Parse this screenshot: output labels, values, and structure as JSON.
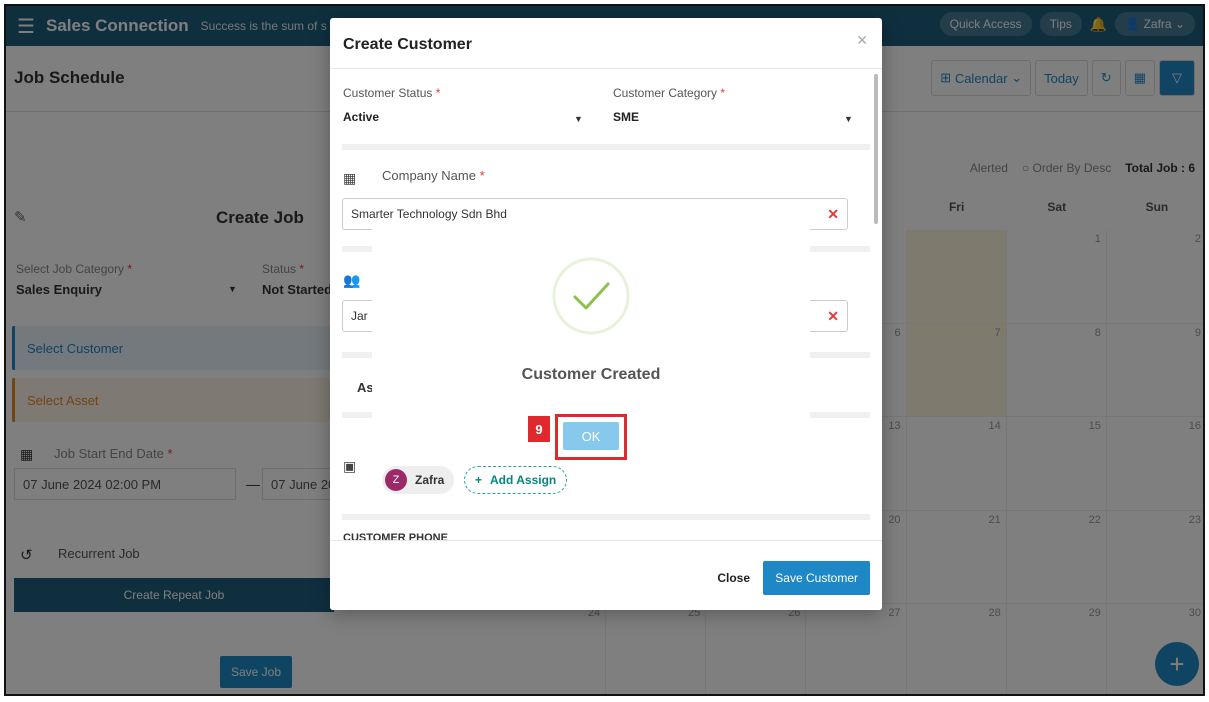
{
  "topbar": {
    "brand": "Sales Connection",
    "slogan": "Success is the sum of s",
    "quick_access": "Quick Access",
    "tips": "Tips",
    "user": "Zafra"
  },
  "page": {
    "title": "Job Schedule",
    "calendar_view": "Calendar",
    "today": "Today"
  },
  "left": {
    "title": "Create Job",
    "job_category_label": "Select Job Category",
    "job_category_value": "Sales Enquiry",
    "status_label": "Status",
    "status_value": "Not Started",
    "select_customer": "Select Customer",
    "select_asset": "Select Asset",
    "date_label": "Job Start End Date",
    "start_date": "07 June 2024 02:00 PM",
    "end_date": "07 June 20",
    "recurrent": "Recurrent Job",
    "repeat_btn": "Create Repeat Job",
    "save_btn": "Save Job"
  },
  "calendar": {
    "alerted": "Alerted",
    "order": "Order By Desc",
    "total": "Total Job : 6",
    "days": [
      "",
      "",
      "",
      "",
      "Fri",
      "Sat",
      "Sun"
    ],
    "cells": [
      "",
      "",
      "",
      "",
      "",
      "1",
      "2",
      "",
      "",
      "",
      "6",
      "7",
      "8",
      "9",
      "",
      "",
      "",
      "13",
      "14",
      "15",
      "16",
      "",
      "",
      "",
      "20",
      "21",
      "22",
      "23",
      "24",
      "25",
      "26",
      "27",
      "28",
      "29",
      "30"
    ]
  },
  "modal": {
    "title": "Create Customer",
    "customer_status_label": "Customer Status",
    "customer_status_value": "Active",
    "customer_category_label": "Customer Category",
    "customer_category_value": "SME",
    "company_label": "Company Name",
    "company_value": "Smarter Technology Sdn Bhd",
    "contact_value": "Jar",
    "assign_section_label": "As",
    "assignee": "Zafra",
    "assignee_initial": "Z",
    "add_assign": "Add Assign",
    "customer_phone": "CUSTOMER PHONE",
    "close_btn": "Close",
    "save_btn": "Save Customer"
  },
  "success": {
    "message": "Customer Created",
    "ok": "OK",
    "step": "9"
  },
  "colors": {
    "topbar": "#1f5e7e",
    "primary": "#1e88c7",
    "highlight": "#e0282f",
    "success": "#8bc34a"
  }
}
